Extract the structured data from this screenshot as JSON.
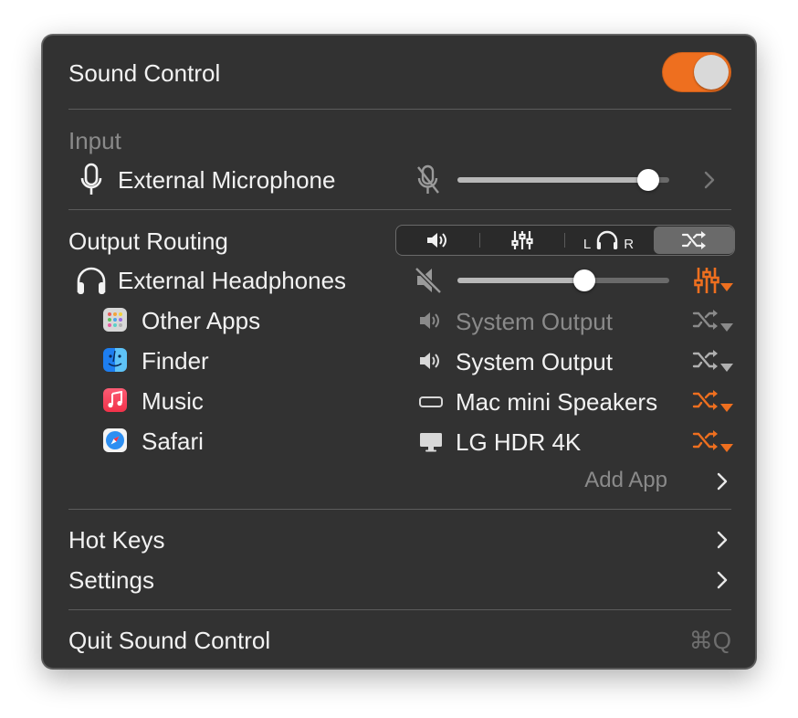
{
  "header": {
    "title": "Sound Control",
    "toggle_on": true,
    "accent_color": "#ee6f1f"
  },
  "input": {
    "section_label": "Input",
    "device_name": "External Microphone",
    "device_icon": "microphone-icon",
    "mute_icon": "microphone-muted-icon",
    "volume": 0.9
  },
  "output": {
    "section_label": "Output Routing",
    "tabs": [
      {
        "icon": "speaker-icon"
      },
      {
        "icon": "equalizer-icon"
      },
      {
        "icon": "headphones-balance-icon",
        "left_label": "L",
        "right_label": "R"
      },
      {
        "icon": "shuffle-routing-icon",
        "selected": true
      }
    ],
    "device_name": "External Headphones",
    "device_icon": "headphones-icon",
    "mute_icon": "speaker-muted-icon",
    "volume": 0.6,
    "apps": [
      {
        "name": "Other Apps",
        "icon": "other-apps-icon",
        "target": "System Output",
        "target_icon": "speaker-icon",
        "target_dim": true,
        "route_active": false
      },
      {
        "name": "Finder",
        "icon": "finder-icon",
        "target": "System Output",
        "target_icon": "speaker-icon",
        "target_dim": false,
        "route_active": false
      },
      {
        "name": "Music",
        "icon": "music-icon",
        "target": "Mac mini Speakers",
        "target_icon": "mac-mini-icon",
        "target_dim": false,
        "route_active": true
      },
      {
        "name": "Safari",
        "icon": "safari-icon",
        "target": "LG HDR 4K",
        "target_icon": "display-icon",
        "target_dim": false,
        "route_active": true
      }
    ],
    "add_app_label": "Add App"
  },
  "menu": {
    "hot_keys": "Hot Keys",
    "settings": "Settings",
    "quit": "Quit Sound Control",
    "quit_shortcut": "⌘Q"
  }
}
